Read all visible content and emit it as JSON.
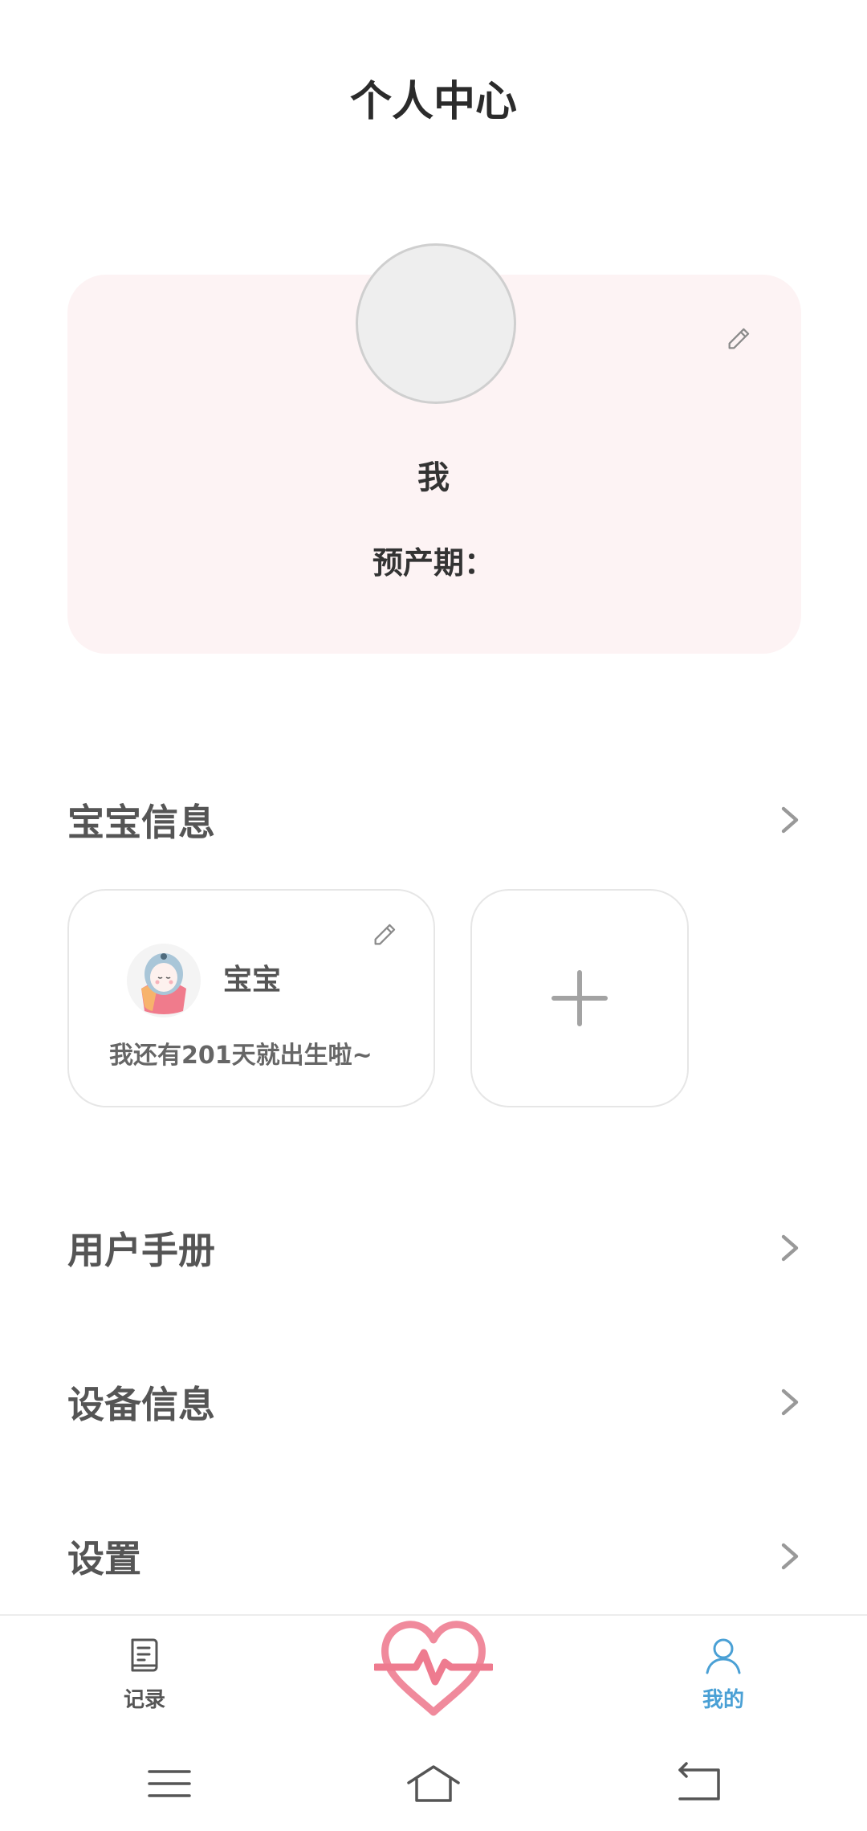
{
  "header": {
    "title": "个人中心"
  },
  "profile": {
    "name": "我",
    "due_date_label": "预产期：",
    "due_date_value": ""
  },
  "baby_section": {
    "title": "宝宝信息",
    "baby": {
      "name": "宝宝",
      "countdown": "我还有201天就出生啦~"
    }
  },
  "menu": {
    "manual": "用户手册",
    "device": "设备信息",
    "settings": "设置"
  },
  "tabbar": {
    "record_label": "记录",
    "mine_label": "我的",
    "active_tab": "我的"
  },
  "colors": {
    "card_background": "#fdf3f4",
    "accent_blue": "#4aa0d5",
    "heart_pink": "#f08a9c"
  },
  "icons": {
    "edit": "pencil-icon",
    "chevron": "chevron-right-icon",
    "add": "plus-icon",
    "record_tab": "document-icon",
    "mine_tab": "person-icon",
    "center_tab": "heartbeat-icon",
    "system": [
      "menu-icon",
      "home-icon",
      "back-icon"
    ]
  }
}
